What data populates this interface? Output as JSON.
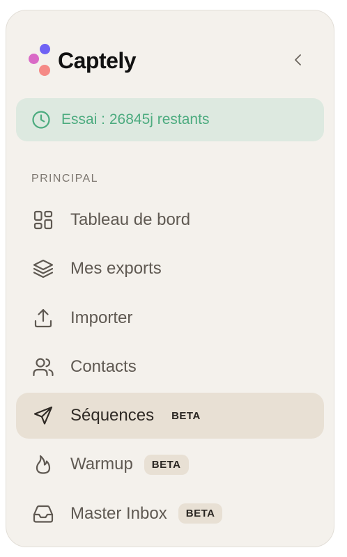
{
  "brand": {
    "name": "Captely",
    "colors": {
      "purple": "#6f62f4",
      "pink": "#d96ac6",
      "coral": "#f58a86"
    }
  },
  "header": {
    "collapse_icon": "chevron-left-icon"
  },
  "trial": {
    "text": "Essai : 26845j restants",
    "icon": "clock-icon",
    "color": "#4cab7f"
  },
  "sidebar": {
    "section_title": "PRINCIPAL",
    "items": [
      {
        "label": "Tableau de bord",
        "icon": "dashboard-grid-icon",
        "badge": "",
        "active": false
      },
      {
        "label": "Mes exports",
        "icon": "layers-icon",
        "badge": "",
        "active": false
      },
      {
        "label": "Importer",
        "icon": "upload-icon",
        "badge": "",
        "active": false
      },
      {
        "label": "Contacts",
        "icon": "users-icon",
        "badge": "",
        "active": false
      },
      {
        "label": "Séquences",
        "icon": "send-icon",
        "badge": "BETA",
        "active": true
      },
      {
        "label": "Warmup",
        "icon": "flame-icon",
        "badge": "BETA",
        "active": false
      },
      {
        "label": "Master Inbox",
        "icon": "inbox-icon",
        "badge": "BETA",
        "active": false
      }
    ]
  }
}
